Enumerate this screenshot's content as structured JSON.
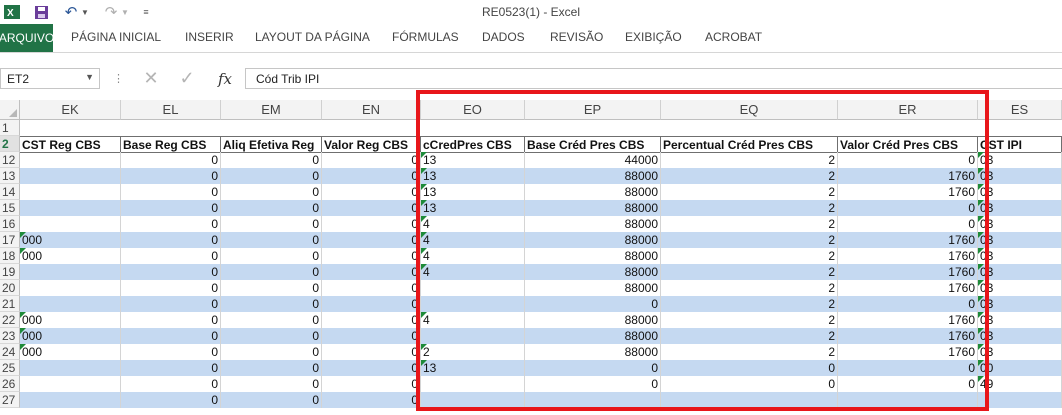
{
  "window": {
    "title": "RE0523(1) - Excel",
    "accent": "#217346"
  },
  "qat": {
    "icons": [
      "excel-logo-icon",
      "save-icon",
      "undo-icon",
      "undo-dropdown-icon",
      "redo-icon",
      "redo-dropdown-icon",
      "customize-qat-icon"
    ]
  },
  "ribbon": {
    "tabs": [
      "ARQUIVO",
      "PÁGINA INICIAL",
      "INSERIR",
      "LAYOUT DA PÁGINA",
      "FÓRMULAS",
      "DADOS",
      "REVISÃO",
      "EXIBIÇÃO",
      "ACROBAT"
    ]
  },
  "formula_bar": {
    "name_box": "ET2",
    "formula": "Cód Trib IPI"
  },
  "sheet": {
    "columns": [
      "EK",
      "EL",
      "EM",
      "EN",
      "EO",
      "EP",
      "EQ",
      "ER",
      "ES"
    ],
    "headers": [
      "CST Reg CBS",
      "Base Reg CBS",
      "Aliq Efetiva Reg",
      "Valor Reg CBS",
      "cCredPres CBS",
      "Base Créd Pres CBS",
      "Percentual Créd Pres CBS",
      "Valor Créd Pres CBS",
      "CST IPI"
    ],
    "header_row": "2",
    "rows": [
      {
        "n": "1",
        "cells": []
      },
      {
        "n": "12",
        "cells": [
          "",
          "0",
          "0",
          "0",
          "13",
          "44000",
          "2",
          "0",
          "03"
        ]
      },
      {
        "n": "13",
        "cells": [
          "",
          "0",
          "0",
          "0",
          "13",
          "88000",
          "2",
          "1760",
          "03"
        ]
      },
      {
        "n": "14",
        "cells": [
          "",
          "0",
          "0",
          "0",
          "13",
          "88000",
          "2",
          "1760",
          "03"
        ]
      },
      {
        "n": "15",
        "cells": [
          "",
          "0",
          "0",
          "0",
          "13",
          "88000",
          "2",
          "0",
          "03"
        ]
      },
      {
        "n": "16",
        "cells": [
          "",
          "0",
          "0",
          "0",
          "4",
          "88000",
          "2",
          "0",
          "03"
        ]
      },
      {
        "n": "17",
        "cells": [
          "000",
          "0",
          "0",
          "0",
          "4",
          "88000",
          "2",
          "1760",
          "03"
        ]
      },
      {
        "n": "18",
        "cells": [
          "000",
          "0",
          "0",
          "0",
          "4",
          "88000",
          "2",
          "1760",
          "03"
        ]
      },
      {
        "n": "19",
        "cells": [
          "",
          "0",
          "0",
          "0",
          "4",
          "88000",
          "2",
          "1760",
          "03"
        ]
      },
      {
        "n": "20",
        "cells": [
          "",
          "0",
          "0",
          "0",
          "",
          "88000",
          "2",
          "1760",
          "03"
        ]
      },
      {
        "n": "21",
        "cells": [
          "",
          "0",
          "0",
          "0",
          "",
          "0",
          "2",
          "0",
          "03"
        ]
      },
      {
        "n": "22",
        "cells": [
          "000",
          "0",
          "0",
          "0",
          "4",
          "88000",
          "2",
          "1760",
          "03"
        ]
      },
      {
        "n": "23",
        "cells": [
          "000",
          "0",
          "0",
          "0",
          "",
          "88000",
          "2",
          "1760",
          "03"
        ]
      },
      {
        "n": "24",
        "cells": [
          "000",
          "0",
          "0",
          "0",
          "2",
          "88000",
          "2",
          "1760",
          "03"
        ]
      },
      {
        "n": "25",
        "cells": [
          "",
          "0",
          "0",
          "0",
          "13",
          "0",
          "0",
          "0",
          "00"
        ]
      },
      {
        "n": "26",
        "cells": [
          "",
          "0",
          "0",
          "0",
          "",
          "0",
          "0",
          "0",
          "49"
        ]
      },
      {
        "n": "27",
        "cells": [
          "",
          "0",
          "0",
          "0",
          "",
          "",
          "",
          "",
          ""
        ]
      }
    ],
    "band_color": "#c5d9f1",
    "highlight_color": "#e8161a"
  }
}
